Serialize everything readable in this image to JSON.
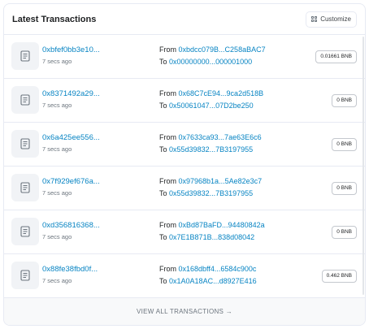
{
  "header": {
    "title": "Latest Transactions",
    "customize_label": "Customize"
  },
  "transactions": [
    {
      "hash": "0xbfef0bb3e10...",
      "age": "7 secs ago",
      "from": "0xbdcc079B...C258aBAC7",
      "to": "0x00000000...000001000",
      "value": "0.01661 BNB"
    },
    {
      "hash": "0x8371492a29...",
      "age": "7 secs ago",
      "from": "0x68C7cE94...9ca2d518B",
      "to": "0x50061047...07D2be250",
      "value": "0 BNB"
    },
    {
      "hash": "0x6a425ee556...",
      "age": "7 secs ago",
      "from": "0x7633ca93...7ae63E6c6",
      "to": "0x55d39832...7B3197955",
      "value": "0 BNB"
    },
    {
      "hash": "0x7f929ef676a...",
      "age": "7 secs ago",
      "from": "0x97968b1a...5Ae82e3c7",
      "to": "0x55d39832...7B3197955",
      "value": "0 BNB"
    },
    {
      "hash": "0xd356816368...",
      "age": "7 secs ago",
      "from": "0xBd87BaFD...94480842a",
      "to": "0x7E1B871B...838d08042",
      "value": "0 BNB"
    },
    {
      "hash": "0x88fe38fbd0f...",
      "age": "7 secs ago",
      "from": "0x168dbff4...6584c900c",
      "to": "0x1A0A18AC...d8927E416",
      "value": "0.462 BNB"
    }
  ],
  "labels": {
    "from": "From",
    "to": "To"
  },
  "footer": {
    "view_all": "VIEW ALL TRANSACTIONS →"
  },
  "colors": {
    "link": "#0784c3",
    "muted": "#6c757e",
    "border": "#e7eaf3"
  },
  "icons": {
    "row_icon": "document-icon",
    "customize_icon": "grid-icon"
  }
}
